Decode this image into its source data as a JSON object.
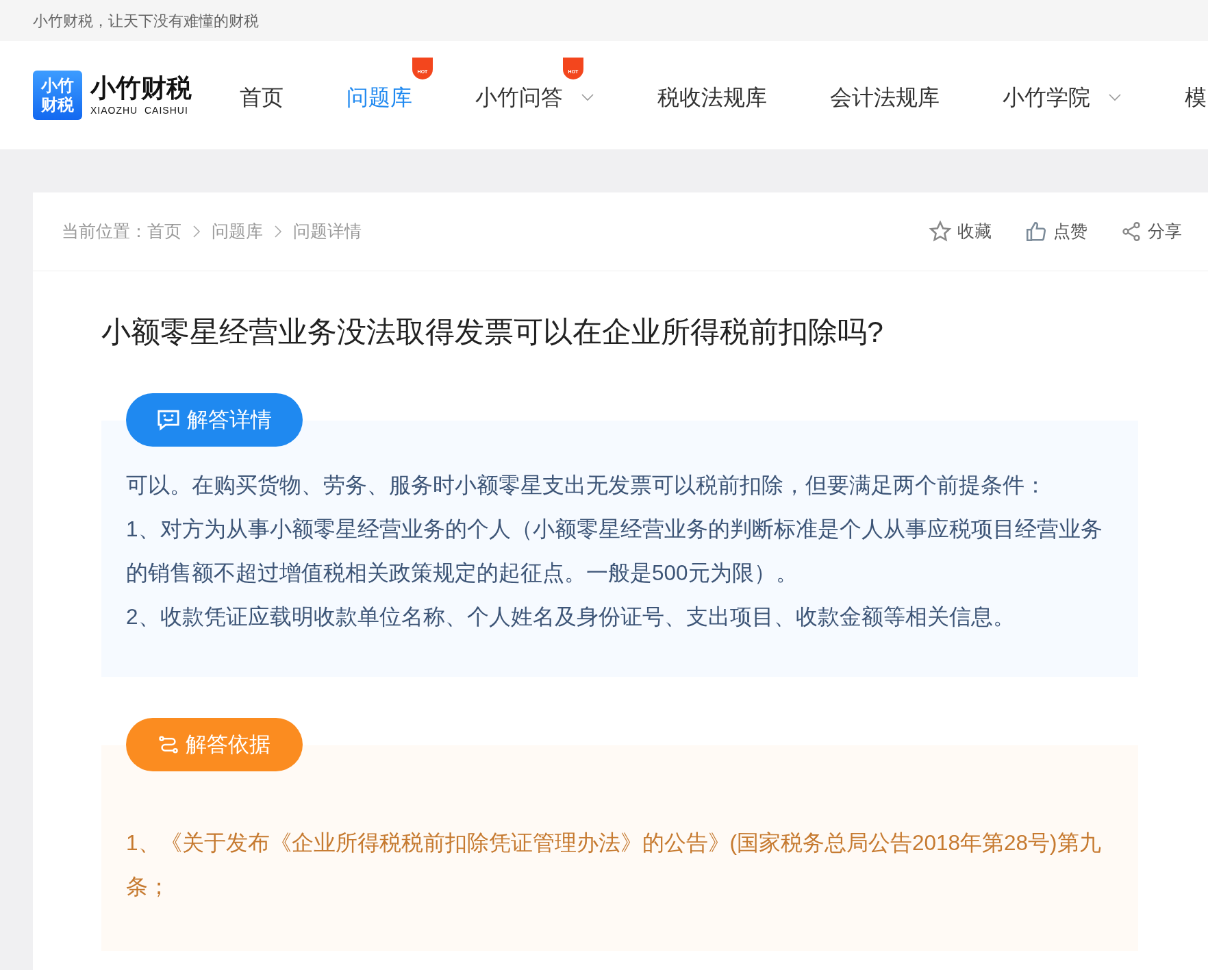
{
  "top_bar": {
    "slogan": "小竹财税，让天下没有难懂的财税"
  },
  "logo": {
    "mark_lines": [
      "小竹",
      "财税"
    ],
    "name": "小竹财税",
    "subtitle": "XIAOZHU  CAISHUI"
  },
  "nav": [
    {
      "label": "首页",
      "selected": false,
      "dropdown": false
    },
    {
      "label": "问题库",
      "selected": true,
      "dropdown": false,
      "badge": "HOT"
    },
    {
      "label": "小竹问答",
      "selected": false,
      "dropdown": true,
      "badge": "HOT"
    },
    {
      "label": "税收法规库",
      "selected": false,
      "dropdown": false
    },
    {
      "label": "会计法规库",
      "selected": false,
      "dropdown": false
    },
    {
      "label": "小竹学院",
      "selected": false,
      "dropdown": true
    },
    {
      "label": "模",
      "selected": false,
      "dropdown": false
    }
  ],
  "breadcrumb": {
    "prefix": "当前位置：",
    "items": [
      "首页",
      "问题库",
      "问题详情"
    ]
  },
  "actions": [
    {
      "kind": "star",
      "label": "收藏"
    },
    {
      "kind": "like",
      "label": "点赞"
    },
    {
      "kind": "share",
      "label": "分享"
    }
  ],
  "question": {
    "title": "小额零星经营业务没法取得发票可以在企业所得税前扣除吗?"
  },
  "sections": [
    {
      "kind": "answer",
      "button": "解答详情",
      "paragraphs": [
        "可以。在购买货物、劳务、服务时小额零星支出无发票可以税前扣除，但要满足两个前提条件：",
        "1、对方为从事小额零星经营业务的个人（小额零星经营业务的判断标准是个人从事应税项目经营业务的销售额不超过增值税相关政策规定的起征点。一般是500元为限）。",
        "2、收款凭证应载明收款单位名称、个人姓名及身份证号、支出项目、收款金额等相关信息。"
      ]
    },
    {
      "kind": "basis",
      "button": "解答依据",
      "paragraphs": [
        "1、《关于发布《企业所得税税前扣除凭证管理办法》的公告》(国家税务总局公告2018年第28号)第九条；"
      ]
    }
  ]
}
